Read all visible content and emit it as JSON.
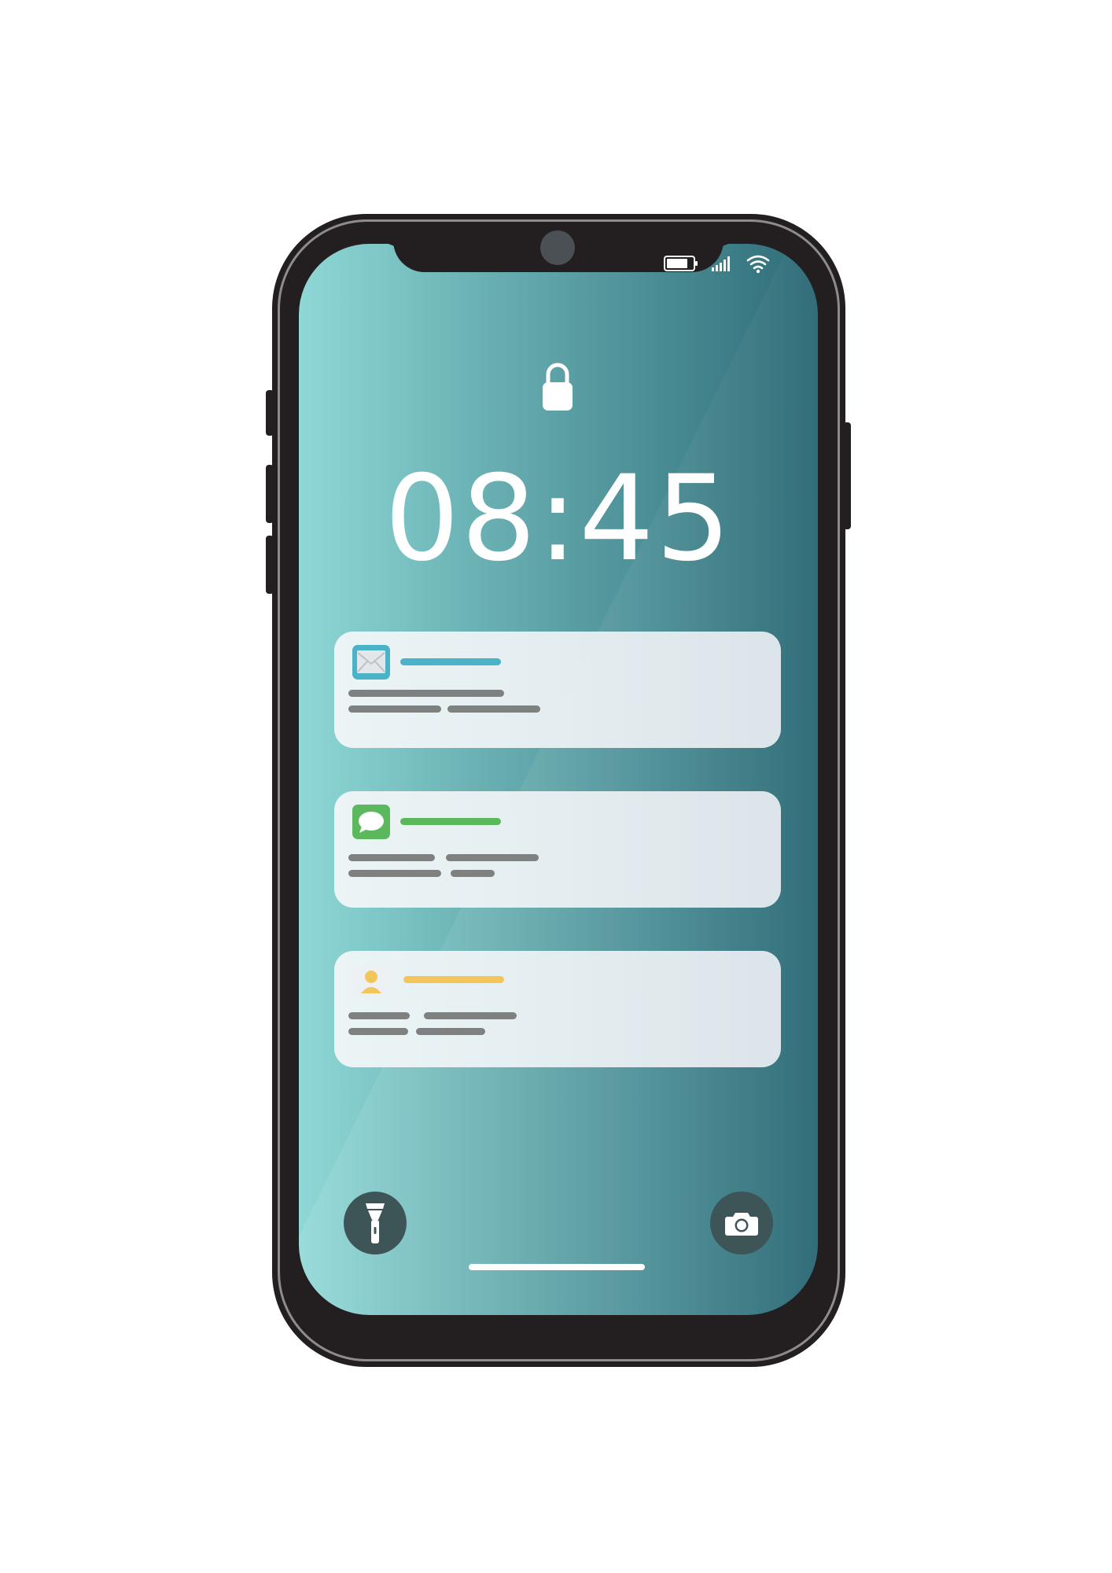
{
  "lock_screen": {
    "time": "08:45",
    "status_icons": [
      "battery-icon",
      "signal-icon",
      "wifi-icon"
    ],
    "lock_icon": "lock-icon"
  },
  "notifications": [
    {
      "app_icon": "mail-icon",
      "accent": "#4bb3c7"
    },
    {
      "app_icon": "message-icon",
      "accent": "#5cb85c"
    },
    {
      "app_icon": "contact-icon",
      "accent": "#f2c65b"
    }
  ],
  "quick_actions": {
    "left": "flashlight-icon",
    "right": "camera-icon"
  },
  "colors": {
    "frame": "#231f20",
    "screen_light": "#8fd8d7",
    "screen_dark": "#2e6b77",
    "card_bg": "#eef4f5",
    "placeholder_text": "#7f8080"
  }
}
